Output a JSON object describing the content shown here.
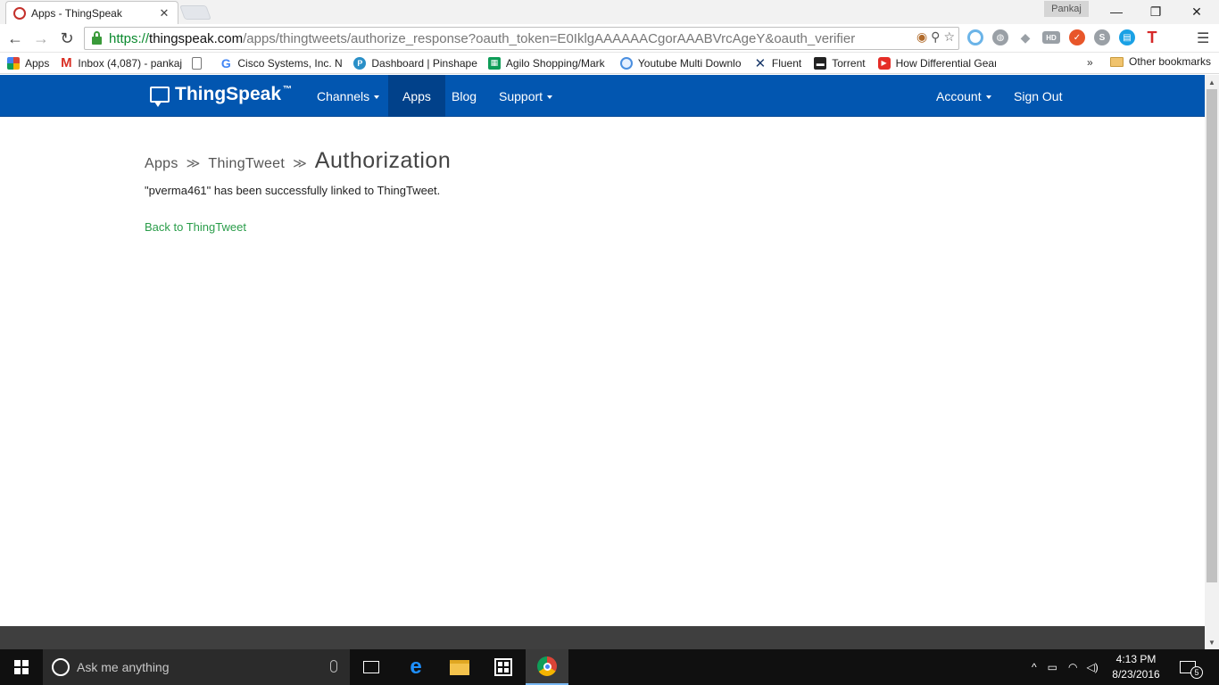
{
  "browser": {
    "tab_title": "Apps - ThingSpeak",
    "tab_close": "✕",
    "profile_name": "Pankaj",
    "url_scheme": "https://",
    "url_host": "thingspeak.com",
    "url_path": "/apps/thingtweets/authorize_response?oauth_token=E0IklgAAAAAACgorAAABVrcAgeY&oauth_verifier",
    "bookmarks": [
      {
        "label": "Apps",
        "icon": "apps-grid-icon"
      },
      {
        "label": "Inbox (4,087) - pankaj",
        "icon": "gmail-icon"
      },
      {
        "label": "",
        "icon": "page-icon"
      },
      {
        "label": "Cisco Systems, Inc. Ne",
        "icon": "google-icon"
      },
      {
        "label": "Dashboard | Pinshape",
        "icon": "pinshape-icon"
      },
      {
        "label": "Agilo Shopping/Mark",
        "icon": "sheets-icon"
      },
      {
        "label": "Youtube Multi Downlo",
        "icon": "download-icon"
      },
      {
        "label": "Fluent",
        "icon": "fluent-icon"
      },
      {
        "label": "Torrent",
        "icon": "torrent-icon"
      },
      {
        "label": "How Differential Gear",
        "icon": "youtube-icon"
      }
    ],
    "bookmarks_more": "»",
    "other_bookmarks": "Other bookmarks"
  },
  "site": {
    "brand": "ThingSpeak",
    "brand_tm": "™",
    "nav": {
      "channels": "Channels",
      "apps": "Apps",
      "blog": "Blog",
      "support": "Support",
      "account": "Account",
      "sign_out": "Sign Out"
    },
    "breadcrumb": {
      "apps": "Apps",
      "thingtweet": "ThingTweet",
      "separator": "≫",
      "current": "Authorization"
    },
    "message": "\"pverma461\" has been successfully linked to ThingTweet.",
    "back_link": "Back to ThingTweet"
  },
  "taskbar": {
    "search_placeholder": "Ask me anything",
    "time": "4:13 PM",
    "date": "8/23/2016",
    "notification_count": "5"
  },
  "colors": {
    "navbar": "#0256b0",
    "nav_active": "#01418a",
    "link_green": "#2a9d4a",
    "footer": "#3f3f3f"
  }
}
